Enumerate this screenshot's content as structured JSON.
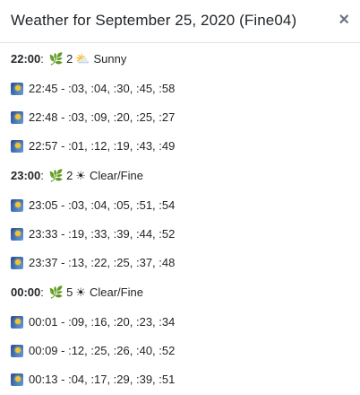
{
  "title": "Weather for September 25, 2020 (Fine04)",
  "close_glyph": "×",
  "hours": [
    {
      "time": "22:00",
      "count": "2",
      "weather_icon": "sun-behind-cloud-icon",
      "weather_glyph": "⛅",
      "condition": "Sunny",
      "times": [
        "22:45 - :03, :04, :30, :45, :58",
        "22:48 - :03, :09, :20, :25, :27",
        "22:57 - :01, :12, :19, :43, :49"
      ]
    },
    {
      "time": "23:00",
      "count": "2",
      "weather_icon": "sun-icon",
      "weather_glyph": "☀",
      "condition": "Clear/Fine",
      "times": [
        "23:05 - :03, :04, :05, :51, :54",
        "23:33 - :19, :33, :39, :44, :52",
        "23:37 - :13, :22, :25, :37, :48"
      ]
    },
    {
      "time": "00:00",
      "count": "5",
      "weather_icon": "sun-icon",
      "weather_glyph": "☀",
      "condition": "Clear/Fine",
      "times": [
        "00:01 - :09, :16, :20, :23, :34",
        "00:09 - :12, :25, :26, :40, :52",
        "00:13 - :04, :17, :29, :39, :51"
      ]
    }
  ],
  "leaf_glyph": "🌿",
  "colon": ":"
}
